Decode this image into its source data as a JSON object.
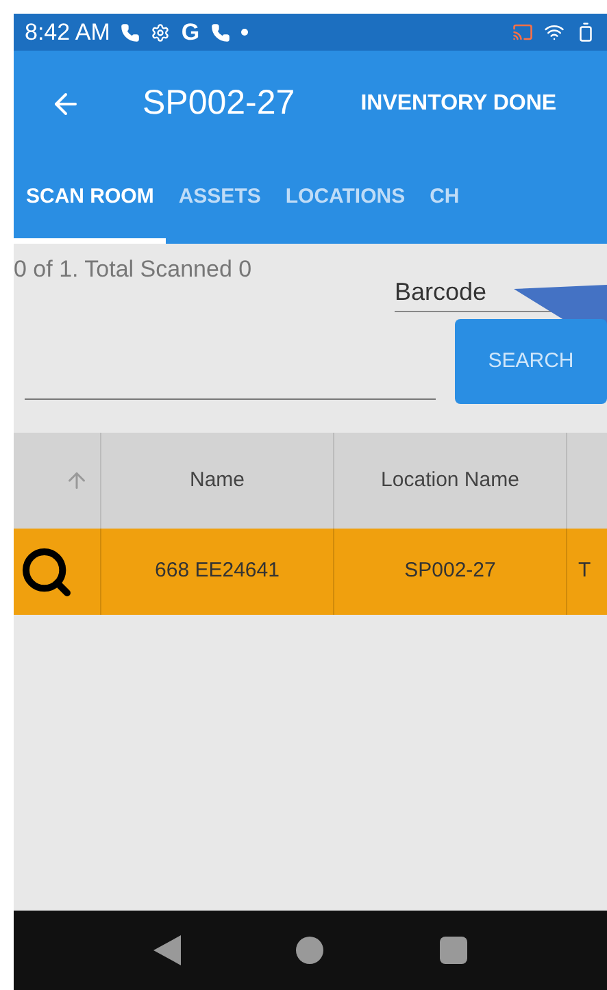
{
  "status_bar": {
    "time": "8:42 AM",
    "g_label": "G"
  },
  "app_bar": {
    "title": "SP002-27",
    "action": "INVENTORY DONE"
  },
  "tabs": [
    {
      "label": "SCAN ROOM",
      "selected": true
    },
    {
      "label": "ASSETS",
      "selected": false
    },
    {
      "label": "LOCATIONS",
      "selected": false
    },
    {
      "label": "CH",
      "selected": false
    }
  ],
  "summary": "0 of 1. Total Scanned 0",
  "barcode_field": {
    "value": "Barcode"
  },
  "search_button": "SEARCH",
  "table": {
    "columns": [
      "Name",
      "Location Name"
    ],
    "rows": [
      {
        "name": "668 EE24641",
        "location": "SP002-27",
        "column_4": "T",
        "highlighted": true
      }
    ]
  }
}
